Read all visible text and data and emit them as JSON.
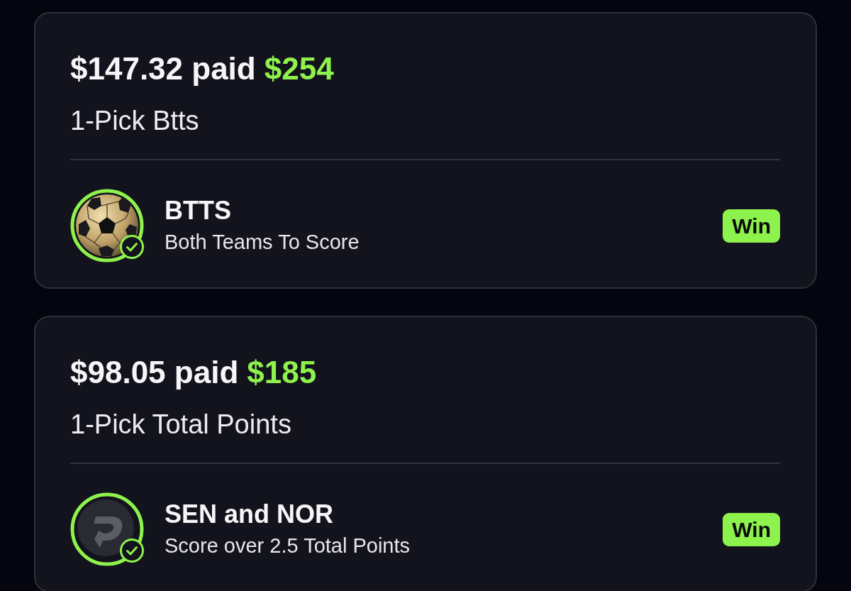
{
  "cards": [
    {
      "stake": "$147.32 paid",
      "payout": "$254",
      "bet_type": "1-Pick Btts",
      "pick": {
        "avatar": {
          "kind": "ball"
        },
        "check": true,
        "title": "BTTS",
        "description": "Both Teams To Score",
        "result": "Win"
      }
    },
    {
      "stake": "$98.05 paid",
      "payout": "$185",
      "bet_type": "1-Pick Total Points",
      "pick": {
        "avatar": {
          "kind": "logo"
        },
        "check": true,
        "title": "SEN and NOR",
        "description": "Score over 2.5 Total Points",
        "result": "Win"
      }
    }
  ]
}
